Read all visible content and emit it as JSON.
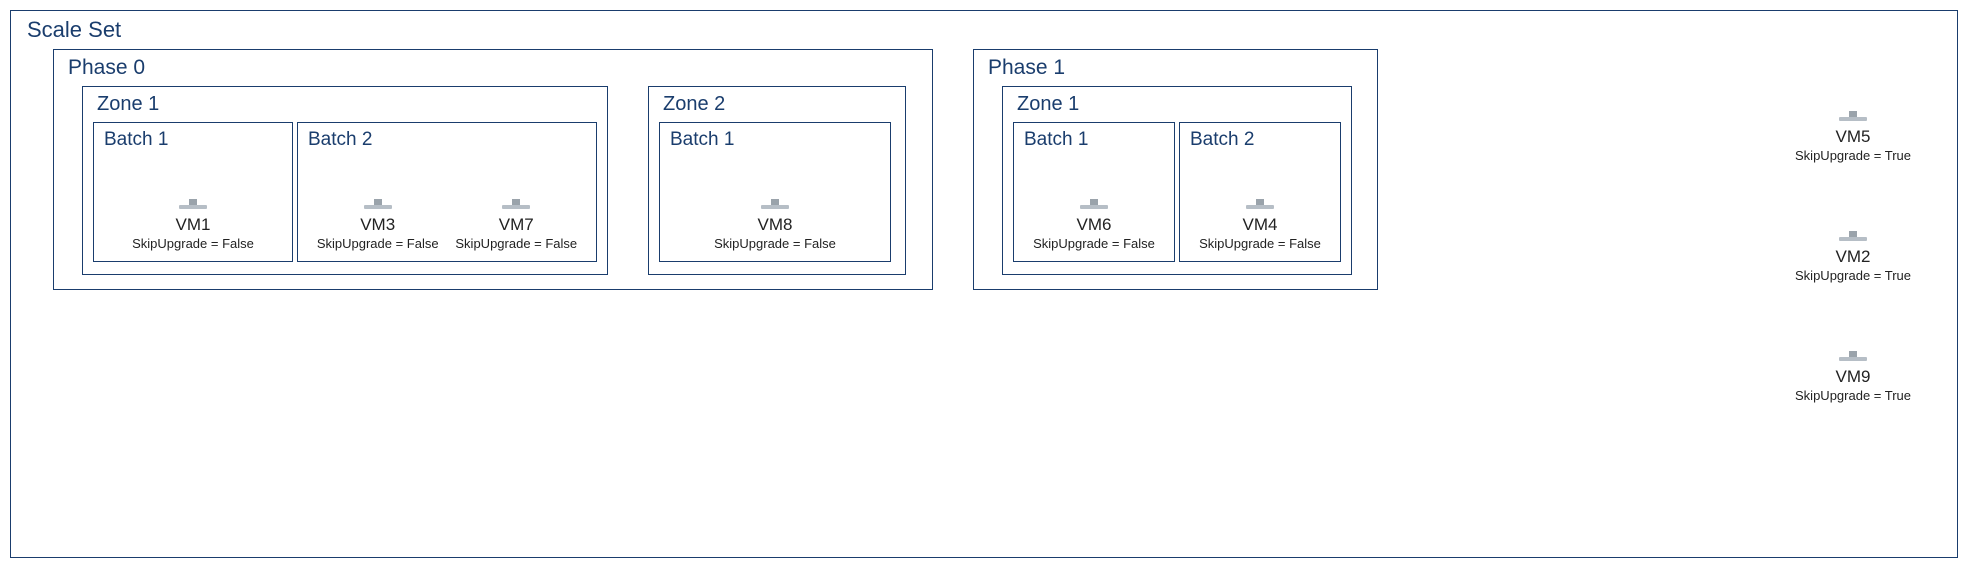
{
  "diagram": {
    "title": "Scale Set",
    "phases": [
      {
        "label": "Phase 0",
        "zones": [
          {
            "label": "Zone 1",
            "batches": [
              {
                "label": "Batch 1",
                "vms": [
                  {
                    "name": "VM1",
                    "skip": "SkipUpgrade = False"
                  }
                ]
              },
              {
                "label": "Batch 2",
                "vms": [
                  {
                    "name": "VM3",
                    "skip": "SkipUpgrade = False"
                  },
                  {
                    "name": "VM7",
                    "skip": "SkipUpgrade = False"
                  }
                ]
              }
            ]
          },
          {
            "label": "Zone 2",
            "batches": [
              {
                "label": "Batch 1",
                "vms": [
                  {
                    "name": "VM8",
                    "skip": "SkipUpgrade = False"
                  }
                ]
              }
            ]
          }
        ]
      },
      {
        "label": "Phase 1",
        "zones": [
          {
            "label": "Zone 1",
            "batches": [
              {
                "label": "Batch 1",
                "vms": [
                  {
                    "name": "VM6",
                    "skip": "SkipUpgrade = False"
                  }
                ]
              },
              {
                "label": "Batch 2",
                "vms": [
                  {
                    "name": "VM4",
                    "skip": "SkipUpgrade = False"
                  }
                ]
              }
            ]
          }
        ]
      }
    ],
    "loose_vms": [
      {
        "name": "VM5",
        "skip": "SkipUpgrade = True"
      },
      {
        "name": "VM2",
        "skip": "SkipUpgrade = True"
      },
      {
        "name": "VM9",
        "skip": "SkipUpgrade = True"
      }
    ]
  }
}
